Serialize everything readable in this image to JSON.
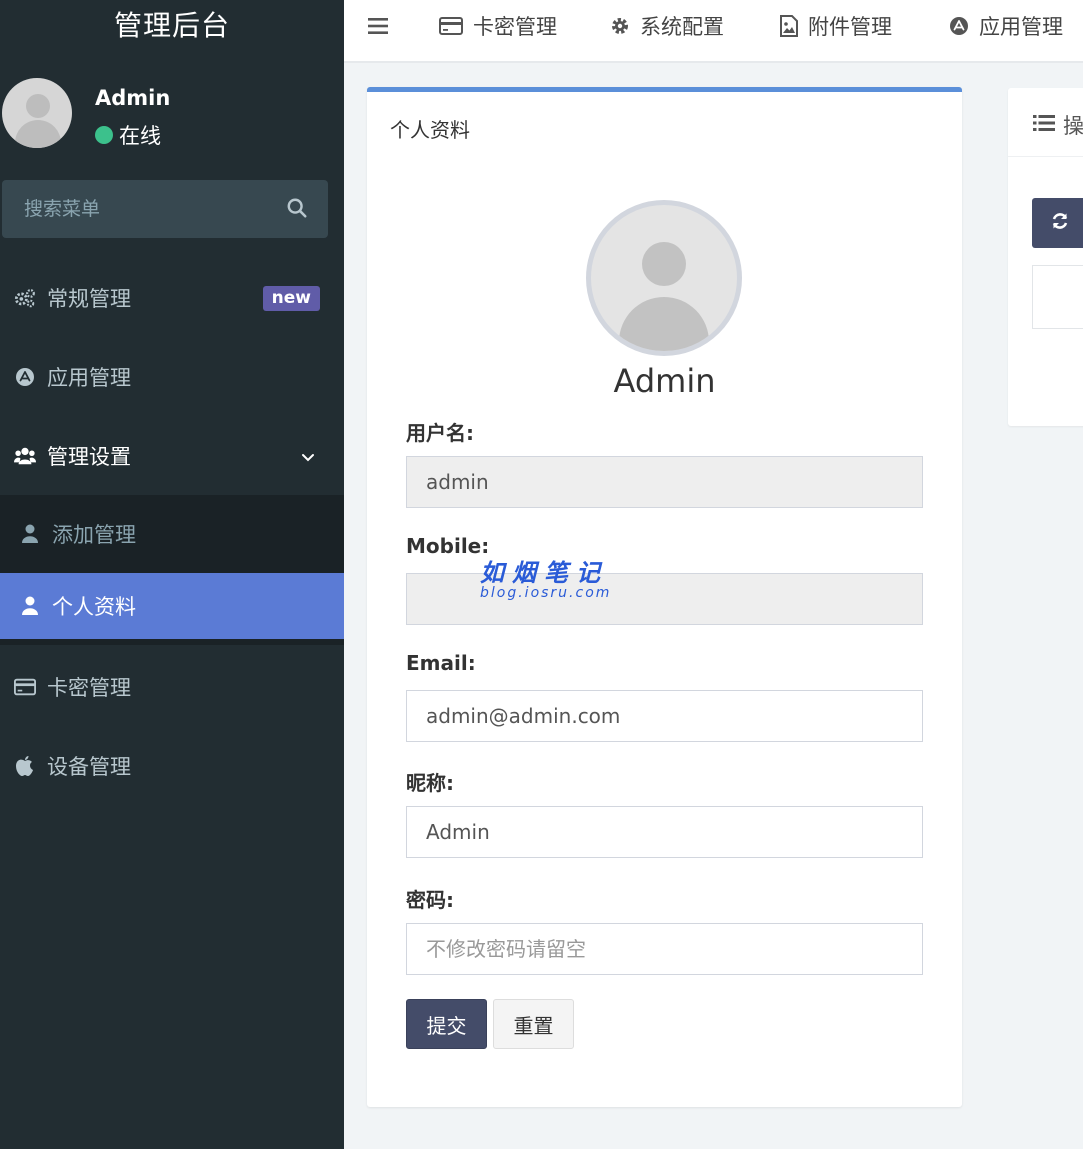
{
  "sidebar": {
    "logo": "管理后台",
    "user": {
      "name": "Admin",
      "status": "在线"
    },
    "search": {
      "placeholder": "搜索菜单"
    },
    "menu": [
      {
        "label": "常规管理",
        "icon": "cogs-icon",
        "badge": "new"
      },
      {
        "label": "应用管理",
        "icon": "app-store-icon"
      },
      {
        "label": "管理设置",
        "icon": "users-icon",
        "expanded": true,
        "children": [
          {
            "label": "添加管理",
            "icon": "user-icon"
          },
          {
            "label": "个人资料",
            "icon": "user-icon",
            "active": true
          }
        ]
      },
      {
        "label": "卡密管理",
        "icon": "credit-card-icon"
      },
      {
        "label": "设备管理",
        "icon": "apple-icon"
      }
    ]
  },
  "topnav": {
    "toggle_icon": "hamburger-menu-icon",
    "items": [
      {
        "label": "卡密管理",
        "icon": "credit-card-icon"
      },
      {
        "label": "系统配置",
        "icon": "gear-icon"
      },
      {
        "label": "附件管理",
        "icon": "image-file-icon"
      },
      {
        "label": "应用管理",
        "icon": "app-store-icon"
      }
    ]
  },
  "profile": {
    "box_title": "个人资料",
    "display_name": "Admin",
    "fields": {
      "username": {
        "label": "用户名:",
        "value": "admin"
      },
      "mobile": {
        "label": "Mobile:",
        "value": ""
      },
      "email": {
        "label": "Email:",
        "value": "admin@admin.com"
      },
      "nickname": {
        "label": "昵称:",
        "value": "Admin"
      },
      "password": {
        "label": "密码:",
        "value": "",
        "placeholder": "不修改密码请留空"
      }
    },
    "submit_label": "提交",
    "reset_label": "重置"
  },
  "watermark": {
    "title": "如烟笔记",
    "url": "blog.iosru.com"
  },
  "side_panel": {
    "title": "操",
    "icon": "list-icon",
    "refresh_icon": "refresh-icon"
  },
  "colors": {
    "sidebar_bg": "#222d32",
    "active_item": "#5b7bd5",
    "box_accent": "#5b8fd9",
    "primary_button": "#444c69",
    "badge": "#605ca8",
    "online": "#3cc18c"
  }
}
